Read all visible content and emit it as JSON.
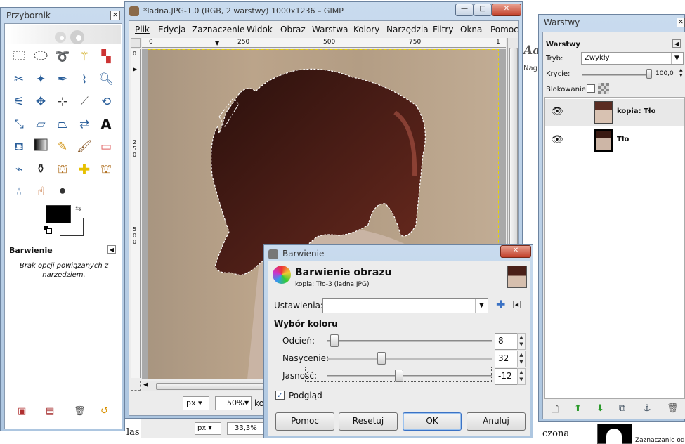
{
  "toolbox": {
    "title": "Przybornik",
    "tool_options_title": "Barwienie",
    "tool_options_text": "Brak opcji powiązanych z narzędziem."
  },
  "gimp_window": {
    "title": "*ladna.JPG-1.0 (RGB, 2 warstwy) 1000x1236 – GIMP",
    "menu": [
      "Plik",
      "Edycja",
      "Zaznaczenie",
      "Widok",
      "Obraz",
      "Warstwa",
      "Kolory",
      "Narzędzia",
      "Filtry",
      "Okna",
      "Pomoc"
    ],
    "ruler_h": [
      "0",
      "250",
      "500",
      "750",
      "1"
    ],
    "ruler_v": [
      "2\n5\n0",
      "5\n0\n0"
    ],
    "unit": "px",
    "zoom": "50%",
    "status_fragment": "kop"
  },
  "back_window": {
    "unit": "px",
    "zoom": "33,3%",
    "text_left": "las",
    "text_right": "czona",
    "heading_fragment": "Aa",
    "side_fragment": "Nag"
  },
  "layers": {
    "title": "Warstwy",
    "tab": "Warstwy",
    "mode_label": "Tryb:",
    "mode_value": "Zwykły",
    "opacity_label": "Krycie:",
    "opacity_value": "100,0",
    "opacity_fraction": 1.0,
    "lock_label": "Blokowanie:",
    "items": [
      {
        "name": "kopia: Tło",
        "selected": true
      },
      {
        "name": "Tło",
        "selected": false
      }
    ],
    "bottom_fragment": "Zaznaczanie od"
  },
  "dialog": {
    "title": "Barwienie",
    "heading": "Barwienie obrazu",
    "subheading": "kopia: Tło-3 (ladna.JPG)",
    "presets_label": "Ustawienia:",
    "presets_value": "",
    "section": "Wybór koloru",
    "hue_label": "Odcień:",
    "hue_value": "8",
    "hue_range": [
      0,
      360
    ],
    "saturation_label": "Nasycenie:",
    "saturation_value": "32",
    "saturation_range": [
      0,
      100
    ],
    "lightness_label": "Jasność:",
    "lightness_value": "-12",
    "lightness_range": [
      -100,
      100
    ],
    "preview_label": "Podgląd",
    "preview_checked": true,
    "buttons": {
      "help": "Pomoc",
      "reset": "Resetuj",
      "ok": "OK",
      "cancel": "Anuluj"
    }
  },
  "colors": {
    "accent": "#3b72c4",
    "hair": "#3a1712",
    "wood": "#b19a80"
  }
}
